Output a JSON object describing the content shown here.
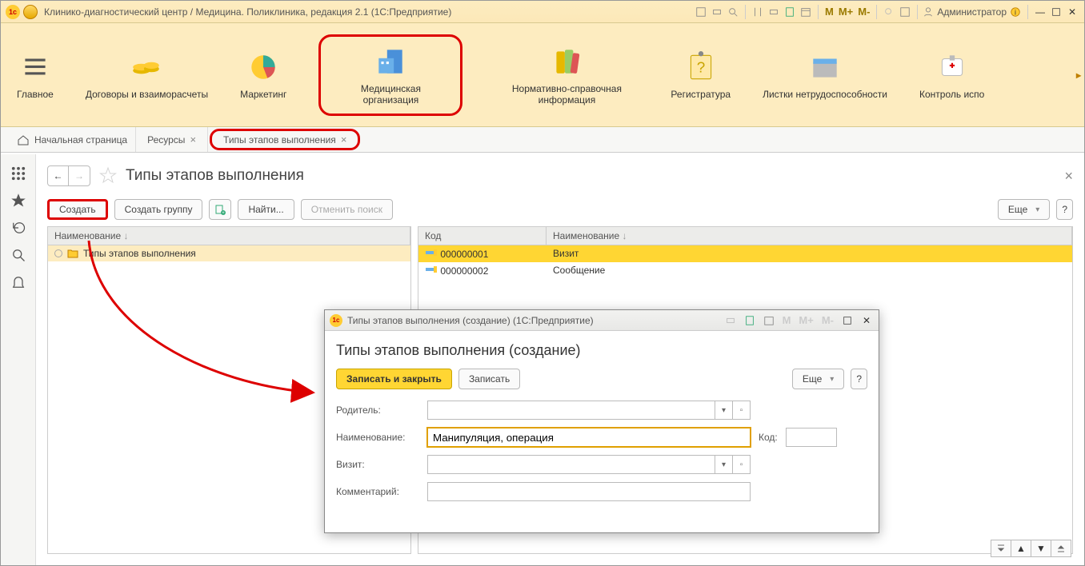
{
  "titlebar": {
    "title": "Клинико-диагностический центр / Медицина. Поликлиника, редакция 2.1  (1С:Предприятие)",
    "user": "Администратор"
  },
  "mainnav": {
    "items": [
      {
        "label": "Главное"
      },
      {
        "label": "Договоры и взаиморасчеты"
      },
      {
        "label": "Маркетинг"
      },
      {
        "label": "Медицинская организация"
      },
      {
        "label": "Нормативно-справочная информация"
      },
      {
        "label": "Регистратура"
      },
      {
        "label": "Листки нетрудоспособности"
      },
      {
        "label": "Контроль испо"
      }
    ]
  },
  "tabs": {
    "home": "Начальная страница",
    "t1": "Ресурсы",
    "t2": "Типы этапов выполнения"
  },
  "page": {
    "title": "Типы этапов выполнения",
    "buttons": {
      "create": "Создать",
      "create_group": "Создать группу",
      "find": "Найти...",
      "cancel_search": "Отменить поиск",
      "more": "Еще"
    },
    "tree": {
      "col1": "Наименование",
      "root": "Типы этапов выполнения"
    },
    "grid": {
      "col_code": "Код",
      "col_name": "Наименование",
      "rows": [
        {
          "code": "000000001",
          "name": "Визит"
        },
        {
          "code": "000000002",
          "name": "Сообщение"
        }
      ]
    }
  },
  "dialog": {
    "title": "Типы этапов выполнения (создание)  (1С:Предприятие)",
    "heading": "Типы этапов выполнения (создание)",
    "buttons": {
      "save_close": "Записать и закрыть",
      "save": "Записать",
      "more": "Еще"
    },
    "fields": {
      "parent": "Родитель:",
      "name": "Наименование:",
      "name_value": "Манипуляция, операция",
      "code": "Код:",
      "visit": "Визит:",
      "comment": "Комментарий:"
    }
  }
}
